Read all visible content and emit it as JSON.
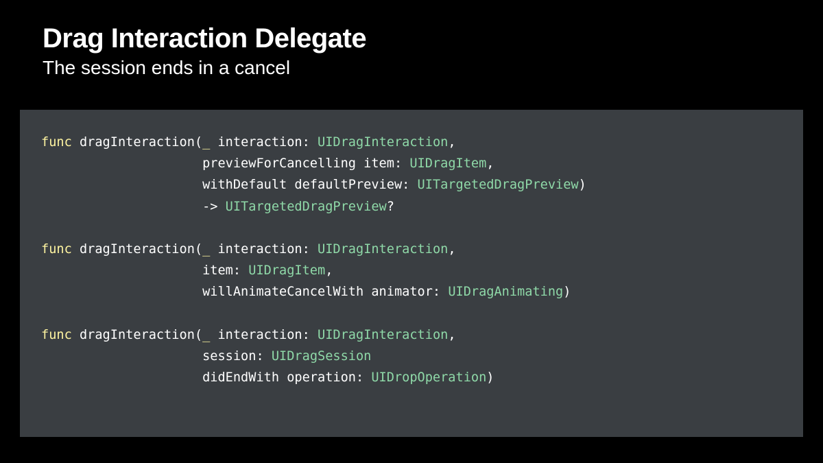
{
  "slide": {
    "title": "Drag Interaction Delegate",
    "subtitle": "The session ends in a cancel"
  },
  "colors": {
    "background": "#000000",
    "code_background": "#3a3e42",
    "keyword": "#fdf3a0",
    "type": "#8fd9a8",
    "text": "#ffffff"
  },
  "code": {
    "lines": [
      [
        {
          "t": "kw",
          "s": "func"
        },
        {
          "t": "pl",
          "s": " dragInteraction("
        },
        {
          "t": "kw",
          "s": "_"
        },
        {
          "t": "pl",
          "s": " interaction: "
        },
        {
          "t": "ty",
          "s": "UIDragInteraction"
        },
        {
          "t": "pl",
          "s": ","
        }
      ],
      [
        {
          "t": "pl",
          "s": "                     previewForCancelling item: "
        },
        {
          "t": "ty",
          "s": "UIDragItem"
        },
        {
          "t": "pl",
          "s": ","
        }
      ],
      [
        {
          "t": "pl",
          "s": "                     withDefault defaultPreview: "
        },
        {
          "t": "ty",
          "s": "UITargetedDragPreview"
        },
        {
          "t": "pl",
          "s": ")"
        }
      ],
      [
        {
          "t": "pl",
          "s": "                     -> "
        },
        {
          "t": "ty",
          "s": "UITargetedDragPreview"
        },
        {
          "t": "pl",
          "s": "?"
        }
      ],
      [],
      [
        {
          "t": "kw",
          "s": "func"
        },
        {
          "t": "pl",
          "s": " dragInteraction("
        },
        {
          "t": "kw",
          "s": "_"
        },
        {
          "t": "pl",
          "s": " interaction: "
        },
        {
          "t": "ty",
          "s": "UIDragInteraction"
        },
        {
          "t": "pl",
          "s": ","
        }
      ],
      [
        {
          "t": "pl",
          "s": "                     item: "
        },
        {
          "t": "ty",
          "s": "UIDragItem"
        },
        {
          "t": "pl",
          "s": ","
        }
      ],
      [
        {
          "t": "pl",
          "s": "                     willAnimateCancelWith animator: "
        },
        {
          "t": "ty",
          "s": "UIDragAnimating"
        },
        {
          "t": "pl",
          "s": ")"
        }
      ],
      [],
      [
        {
          "t": "kw",
          "s": "func"
        },
        {
          "t": "pl",
          "s": " dragInteraction("
        },
        {
          "t": "kw",
          "s": "_"
        },
        {
          "t": "pl",
          "s": " interaction: "
        },
        {
          "t": "ty",
          "s": "UIDragInteraction"
        },
        {
          "t": "pl",
          "s": ","
        }
      ],
      [
        {
          "t": "pl",
          "s": "                     session: "
        },
        {
          "t": "ty",
          "s": "UIDragSession"
        }
      ],
      [
        {
          "t": "pl",
          "s": "                     didEndWith operation: "
        },
        {
          "t": "ty",
          "s": "UIDropOperation"
        },
        {
          "t": "pl",
          "s": ")"
        }
      ]
    ]
  }
}
